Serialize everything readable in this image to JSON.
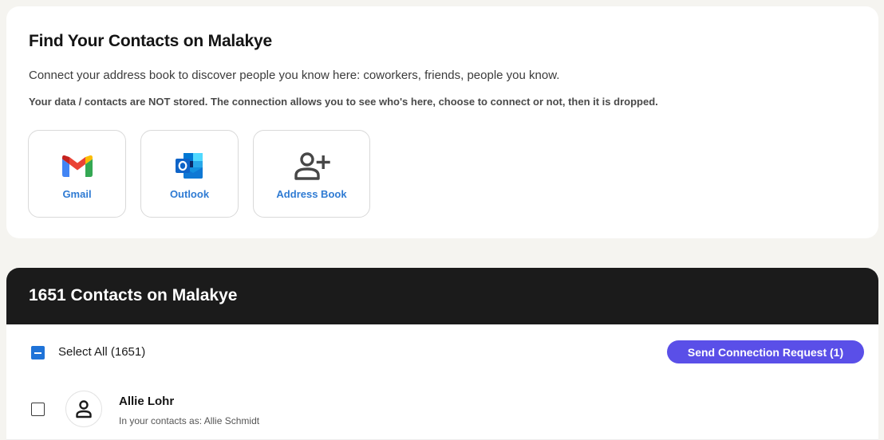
{
  "find_section": {
    "title": "Find Your Contacts on Malakye",
    "description": "Connect your address book to discover people you know here: coworkers, friends, people you know.",
    "note": "Your data / contacts are NOT stored. The connection allows you to see who's here, choose to connect or not, then it is dropped.",
    "providers": [
      {
        "label": "Gmail",
        "icon": "gmail-icon"
      },
      {
        "label": "Outlook",
        "icon": "outlook-icon"
      },
      {
        "label": "Address Book",
        "icon": "add-person-icon"
      }
    ]
  },
  "contacts_section": {
    "title": "1651 Contacts on Malakye",
    "select_all_label": "Select All (1651)",
    "send_button_label": "Send Connection Request (1)",
    "contacts": [
      {
        "name": "Allie Lohr",
        "subtitle": "In your contacts as: Allie Schmidt"
      }
    ]
  },
  "colors": {
    "accent_button": "#5a4fe8",
    "checkbox_blue": "#1f73d8",
    "provider_label": "#2f7bd3",
    "header_bg": "#1b1b1b"
  }
}
